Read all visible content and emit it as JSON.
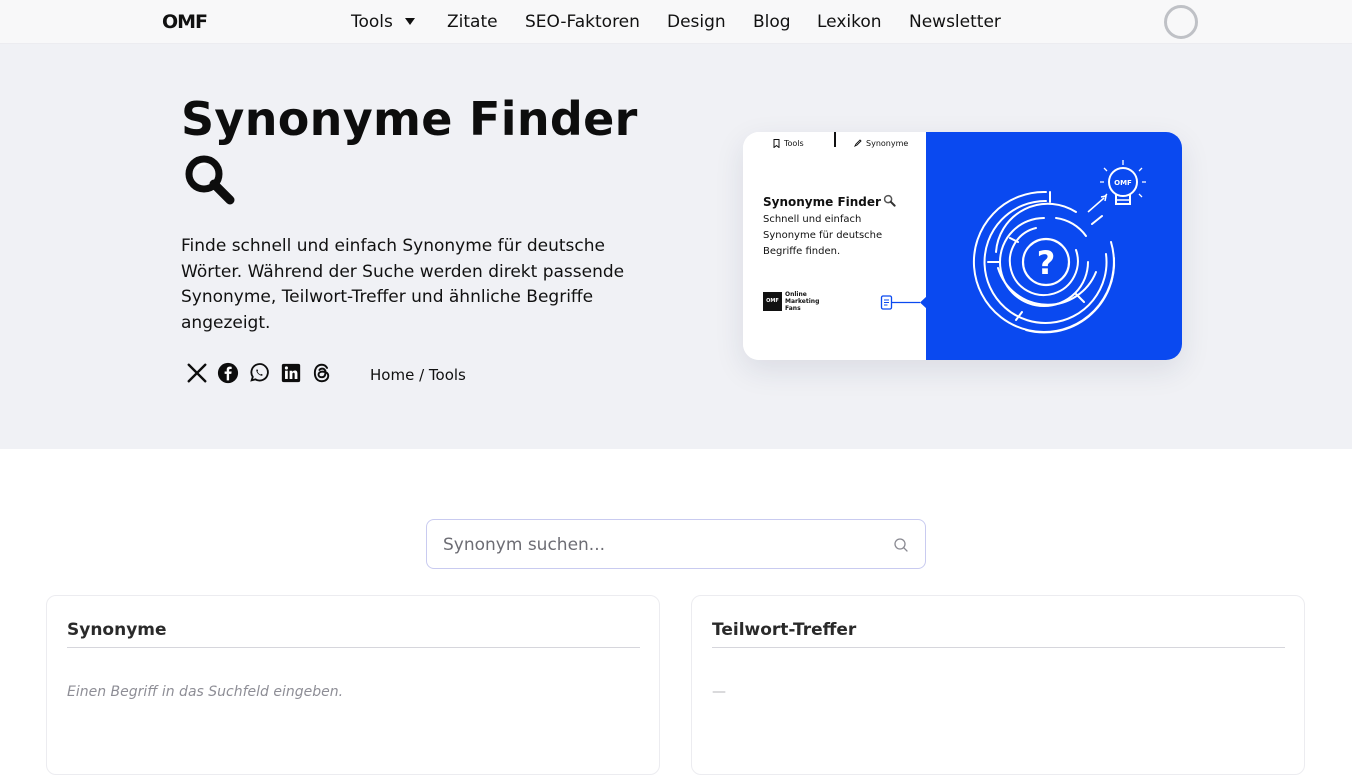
{
  "nav": {
    "logo": "OMF",
    "items": [
      {
        "label": "Tools",
        "has_dropdown": true
      },
      {
        "label": "Zitate"
      },
      {
        "label": "SEO-Faktoren"
      },
      {
        "label": "Design"
      },
      {
        "label": "Blog"
      },
      {
        "label": "Lexikon"
      },
      {
        "label": "Newsletter"
      }
    ],
    "user_icon": "avatar-ring-icon"
  },
  "hero": {
    "title": "Synonyme Finder",
    "title_icon": "magnifier-icon",
    "description": "Finde schnell und einfach Synonyme für deutsche Wörter. Während der Suche werden direkt passende Synonyme, Teilwort-Treffer und ähnliche Begriffe angezeigt.",
    "socials": [
      "x-icon",
      "facebook-icon",
      "whatsapp-icon",
      "linkedin-icon",
      "threads-icon"
    ],
    "breadcrumb": {
      "home": "Home",
      "separator": "/",
      "current": "Tools"
    },
    "card": {
      "tab_left": "Tools",
      "tab_right": "Synonyme",
      "title": "Synonyme Finder",
      "subtitle": "Schnell und einfach Synonyme für deutsche Begriffe finden.",
      "logo_mark": "OMF",
      "logo_text": "Online Marketing Fans",
      "accent_color": "#0a49f0",
      "bulb_label": "OMF",
      "maze_symbol": "?"
    }
  },
  "search": {
    "placeholder": "Synonym suchen...",
    "value": ""
  },
  "panels": {
    "synonyms": {
      "title": "Synonyme",
      "empty_text": "Einen Begriff in das Suchfeld eingeben."
    },
    "partial": {
      "title": "Teilwort-Treffer",
      "empty_text": "—"
    }
  }
}
